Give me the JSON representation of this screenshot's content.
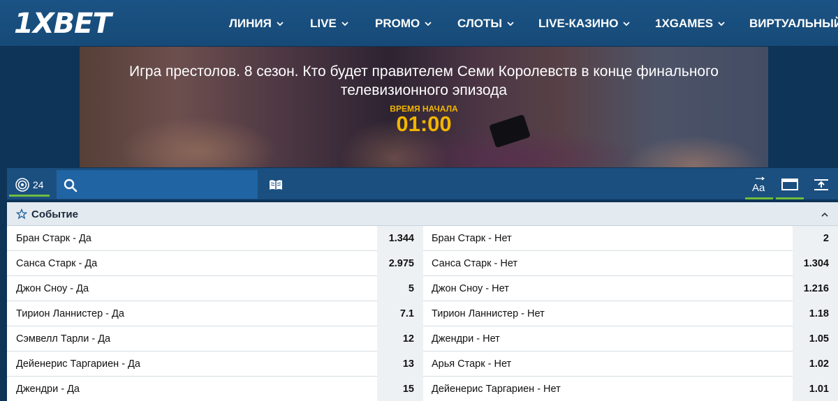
{
  "header": {
    "logo_prefix": "1X",
    "logo_suffix": "BET",
    "nav": [
      {
        "label": "ЛИНИЯ",
        "has_dropdown": true
      },
      {
        "label": "LIVE",
        "has_dropdown": true
      },
      {
        "label": "PROMO",
        "has_dropdown": true
      },
      {
        "label": "СЛОТЫ",
        "has_dropdown": true
      },
      {
        "label": "LIVE-КАЗИНО",
        "has_dropdown": true
      },
      {
        "label": "1XGAMES",
        "has_dropdown": true
      },
      {
        "label": "ВИРТУАЛЬНЫЙ",
        "has_dropdown": false
      }
    ]
  },
  "banner": {
    "title": "Игра престолов. 8 сезон. Кто будет правителем Семи Королевств в конце финального телевизионного эпизода",
    "start_label": "ВРЕМЯ НАЧАЛА",
    "start_time": "01:00"
  },
  "toolbar": {
    "live_count": "24",
    "search_placeholder": "",
    "icons": [
      "live-icon",
      "search-icon",
      "book-icon",
      "font-size-icon",
      "window-view-icon",
      "pin-top-icon"
    ]
  },
  "table": {
    "header": "Событие",
    "rows": [
      {
        "left_name": "Бран Старк - Да",
        "left_odd": "1.344",
        "right_name": "Бран Старк - Нет",
        "right_odd": "2"
      },
      {
        "left_name": "Санса Старк - Да",
        "left_odd": "2.975",
        "right_name": "Санса Старк - Нет",
        "right_odd": "1.304"
      },
      {
        "left_name": "Джон Сноу - Да",
        "left_odd": "5",
        "right_name": "Джон Сноу - Нет",
        "right_odd": "1.216"
      },
      {
        "left_name": "Тирион Ланнистер - Да",
        "left_odd": "7.1",
        "right_name": "Тирион Ланнистер - Нет",
        "right_odd": "1.18"
      },
      {
        "left_name": "Сэмвелл Тарли - Да",
        "left_odd": "12",
        "right_name": "Джендри - Нет",
        "right_odd": "1.05"
      },
      {
        "left_name": "Дейенерис Таргариен - Да",
        "left_odd": "13",
        "right_name": "Арья Старк - Нет",
        "right_odd": "1.02"
      },
      {
        "left_name": "Джендри - Да",
        "left_odd": "15",
        "right_name": "Дейенерис Таргариен - Нет",
        "right_odd": "1.01"
      }
    ]
  },
  "colors": {
    "topbar": "#1b5384",
    "toolbar": "#1a4f80",
    "accent_green": "#6fbd3e",
    "timer_yellow": "#f2b600"
  }
}
